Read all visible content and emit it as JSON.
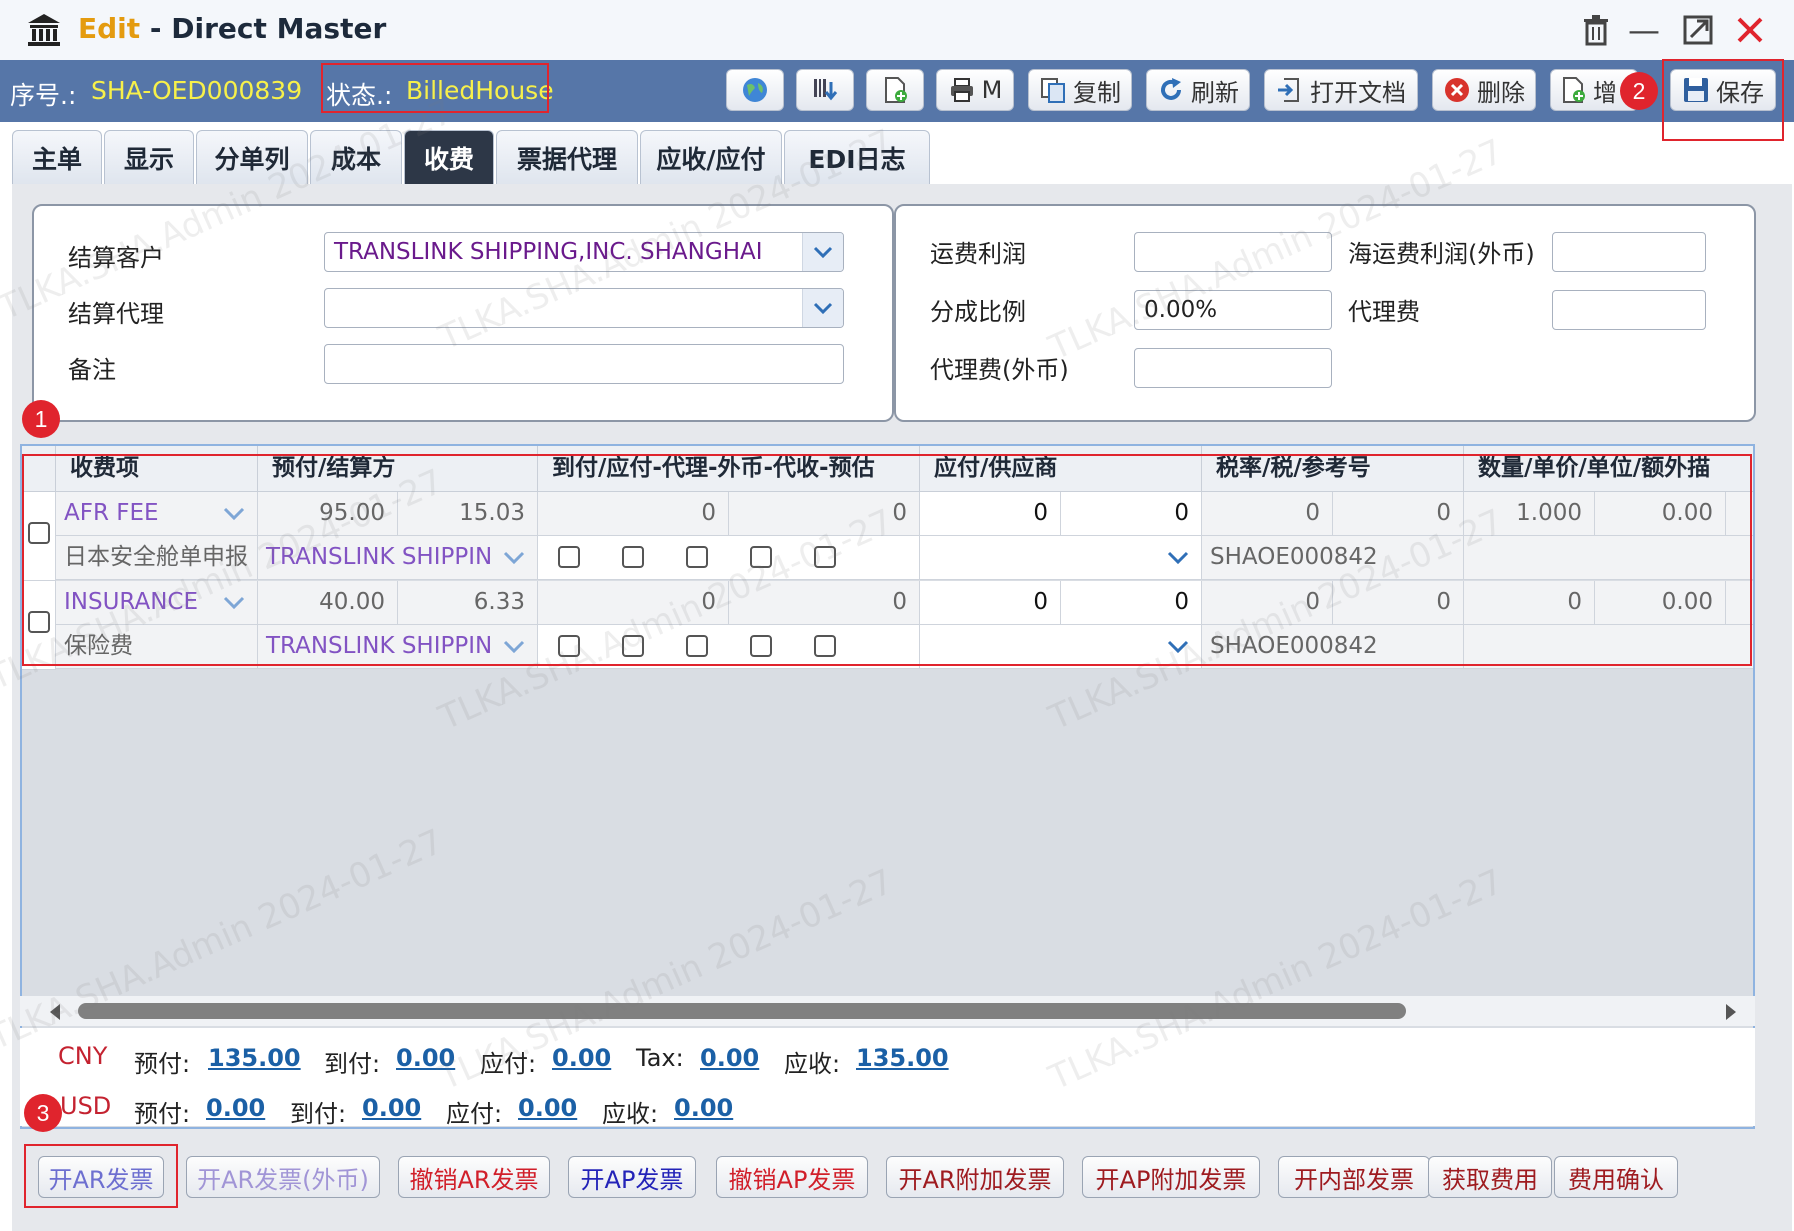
{
  "window": {
    "title_edit": "Edit",
    "title_sep": " - ",
    "title_rest": "Direct Master",
    "minimize": "—"
  },
  "toolbar": {
    "seq_label": "序号.:",
    "seq_value": "SHA-OED000839",
    "status_label": "状态.:",
    "status_value": "BilledHouse",
    "print_label": "M",
    "copy_label": "复制",
    "refresh_label": "刷新",
    "open_doc_label": "打开文档",
    "delete_label": "删除",
    "add_label": "增",
    "save_label": "保存"
  },
  "tabs": [
    "主单",
    "显示",
    "分单列",
    "成本",
    "收费",
    "票据代理",
    "应收/应付",
    "EDI日志"
  ],
  "active_tab": "收费",
  "form_left": {
    "customer_label": "结算客户",
    "customer_value": "TRANSLINK SHIPPING,INC. SHANGHAI",
    "agent_label": "结算代理",
    "agent_value": "",
    "remark_label": "备注",
    "remark_value": ""
  },
  "form_right": {
    "freight_profit_label": "运费利润",
    "freight_profit_value": "",
    "ocean_profit_label": "海运费利润(外币)",
    "ocean_profit_value": "",
    "share_ratio_label": "分成比例",
    "share_ratio_value": "0.00%",
    "agent_fee_label": "代理费",
    "agent_fee_value": "",
    "agent_fee_fx_label": "代理费(外币)",
    "agent_fee_fx_value": ""
  },
  "grid": {
    "headers": [
      "收费项",
      "预付/结算方",
      "到付/应付-代理-外币-代收-预估",
      "应付/供应商",
      "税率/税/参考号",
      "数量/单价/单位/额外描"
    ],
    "rows": [
      {
        "item": "AFR FEE",
        "item_desc": "日本安全舱单申报",
        "prepaid": "95.00",
        "prepaid2": "15.03",
        "settle": "TRANSLINK SHIPPIN",
        "collect": "0",
        "collect2": "0",
        "payable": "0",
        "payable2": "0",
        "tax": "0",
        "tax2": "0",
        "ref": "SHAOE000842",
        "qty": "1.000",
        "price": "0.00"
      },
      {
        "item": "INSURANCE",
        "item_desc": "保险费",
        "prepaid": "40.00",
        "prepaid2": "6.33",
        "settle": "TRANSLINK SHIPPIN",
        "collect": "0",
        "collect2": "0",
        "payable": "0",
        "payable2": "0",
        "tax": "0",
        "tax2": "0",
        "ref": "SHAOE000842",
        "qty": "0",
        "price": "0.00"
      }
    ]
  },
  "summary": {
    "cny": {
      "currency": "CNY",
      "prepaid_label": "预付:",
      "prepaid": "135.00",
      "collect_label": "到付:",
      "collect": "0.00",
      "payable_label": "应付:",
      "payable": "0.00",
      "tax_label": "Tax:",
      "tax": "0.00",
      "receivable_label": "应收:",
      "receivable": "135.00"
    },
    "usd": {
      "currency": "USD",
      "prepaid_label": "预付:",
      "prepaid": "0.00",
      "collect_label": "到付:",
      "collect": "0.00",
      "payable_label": "应付:",
      "payable": "0.00",
      "receivable_label": "应收:",
      "receivable": "0.00"
    }
  },
  "bottom_buttons": [
    "开AR发票",
    "开AR发票(外币)",
    "撤销AR发票",
    "开AP发票",
    "撤销AP发票",
    "开AR附加发票",
    "开AP附加发票",
    "开内部发票",
    "获取费用",
    "费用确认"
  ],
  "markers": [
    "1",
    "2",
    "3"
  ],
  "watermark": "TLKA.SHA.Admin 2024-01-27",
  "colors": {
    "toolbar_bg": "#5676a8",
    "status_yellow": "#f7f04a",
    "highlight_red": "#e0242d",
    "purple_text": "#8253c3",
    "link_blue": "#1b60a6"
  }
}
